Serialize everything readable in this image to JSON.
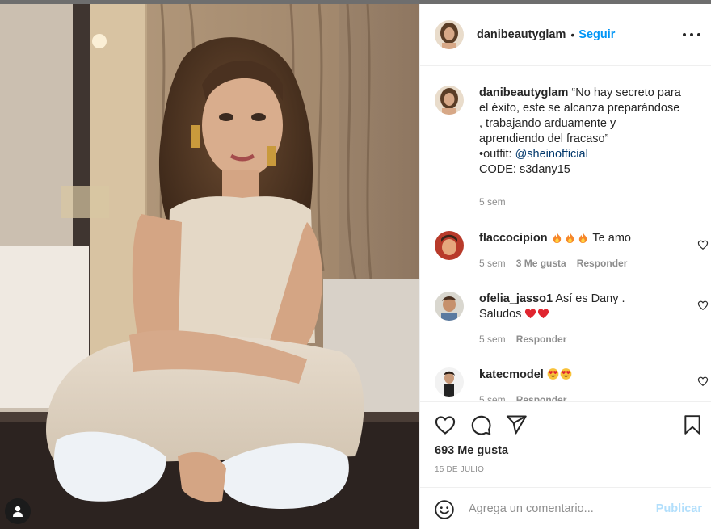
{
  "colors": {
    "accent": "#0095f6",
    "mention": "#00376b",
    "muted": "#8e8e8e",
    "post_disabled": "#b2dffc",
    "emoji_heart": "#e0252f"
  },
  "post": {
    "header": {
      "username": "danibeautyglam",
      "separator": "•",
      "follow_label": "Seguir",
      "more_icon": "more-horizontal-icon"
    },
    "caption": {
      "username": "danibeautyglam",
      "text_lines": [
        "“No hay secreto para",
        "el éxito, este se alcanza preparándose",
        ", trabajando arduamente y",
        "aprendiendo del fracaso”"
      ],
      "outfit_prefix": "•outfit: ",
      "outfit_mention": "@sheinofficial",
      "code_line": "CODE: s3dany15",
      "time": "5 sem"
    },
    "comments": [
      {
        "username": "flaccocipion",
        "emoji": [
          "fire",
          "fire",
          "fire"
        ],
        "text": "Te amo",
        "time": "5 sem",
        "likes": "3 Me gusta",
        "reply_label": "Responder"
      },
      {
        "username": "ofelia_jasso1",
        "text": "Así es Dany .",
        "text_line2": "Saludos",
        "emoji": [
          "red-heart",
          "red-heart"
        ],
        "time": "5 sem",
        "reply_label": "Responder"
      },
      {
        "username": "katecmodel",
        "emoji": [
          "heart-eyes",
          "heart-eyes"
        ],
        "time": "5 sem",
        "reply_label": "Responder"
      }
    ],
    "actions": {
      "icons": [
        "heart-icon",
        "comment-icon",
        "share-icon",
        "bookmark-icon"
      ],
      "likes_label": "693 Me gusta",
      "date_label": "15 DE JULIO"
    },
    "composer": {
      "placeholder": "Agrega un comentario...",
      "post_label": "Publicar",
      "emoji_icon": "smile-icon"
    }
  }
}
